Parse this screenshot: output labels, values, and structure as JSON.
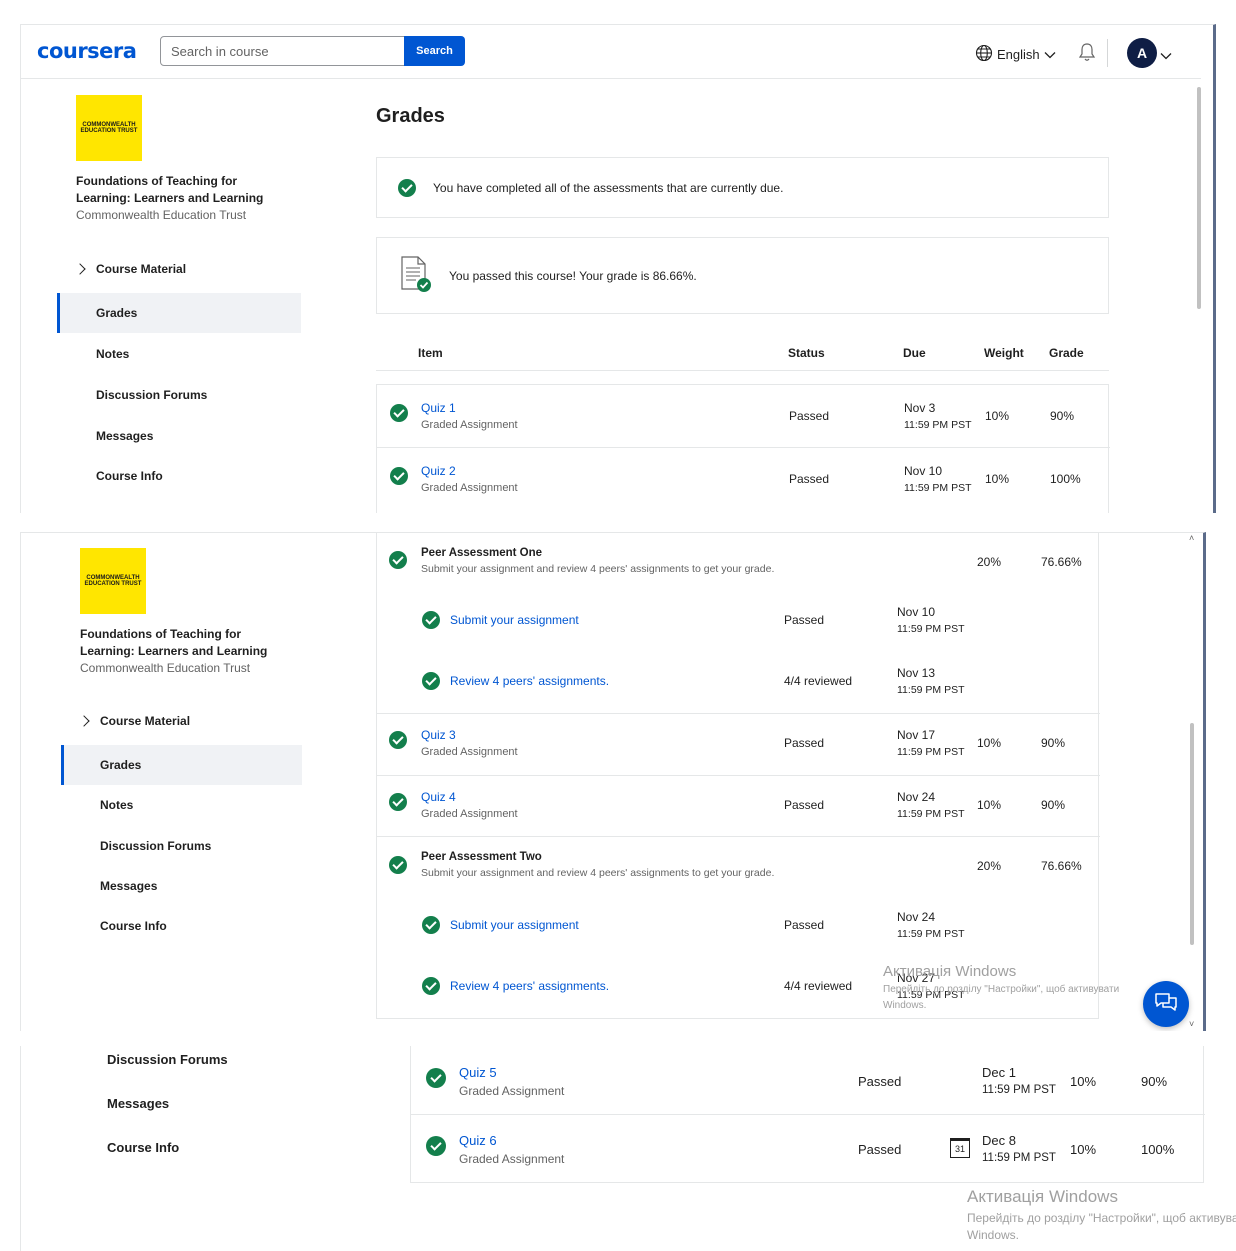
{
  "header": {
    "logo": "coursera",
    "search_placeholder": "Search in course",
    "search_button": "Search",
    "language": "English",
    "avatar_initial": "A"
  },
  "sidebar": {
    "course_title": "Foundations of Teaching for Learning: Learners and Learning",
    "course_org": "Commonwealth Education Trust",
    "logo_text": "COMMONWEALTH EDUCATION TRUST",
    "items": {
      "course_material": "Course Material",
      "grades": "Grades",
      "notes": "Notes",
      "discussion_forums": "Discussion Forums",
      "messages": "Messages",
      "course_info": "Course Info"
    }
  },
  "main": {
    "title": "Grades",
    "completed_msg": "You have completed all of the assessments that are currently due.",
    "passed_msg": "You passed this course! Your grade is 86.66%.",
    "columns": {
      "item": "Item",
      "status": "Status",
      "due": "Due",
      "weight": "Weight",
      "grade": "Grade"
    },
    "quiz1": {
      "name": "Quiz 1",
      "type": "Graded Assignment",
      "status": "Passed",
      "due_date": "Nov 3",
      "due_time": "11:59 PM PST",
      "weight": "10%",
      "grade": "90%"
    },
    "quiz2": {
      "name": "Quiz 2",
      "type": "Graded Assignment",
      "status": "Passed",
      "due_date": "Nov 10",
      "due_time": "11:59 PM PST",
      "weight": "10%",
      "grade": "100%"
    },
    "peer1": {
      "name": "Peer Assessment One",
      "desc": "Submit your assignment and review 4 peers' assignments to get your grade.",
      "weight": "20%",
      "grade": "76.66%",
      "submit": {
        "name": "Submit your assignment",
        "status": "Passed",
        "due_date": "Nov 10",
        "due_time": "11:59 PM PST"
      },
      "review": {
        "name": "Review 4 peers' assignments.",
        "status": "4/4 reviewed",
        "due_date": "Nov 13",
        "due_time": "11:59 PM PST"
      }
    },
    "quiz3": {
      "name": "Quiz 3",
      "type": "Graded Assignment",
      "status": "Passed",
      "due_date": "Nov 17",
      "due_time": "11:59 PM PST",
      "weight": "10%",
      "grade": "90%"
    },
    "quiz4": {
      "name": "Quiz 4",
      "type": "Graded Assignment",
      "status": "Passed",
      "due_date": "Nov 24",
      "due_time": "11:59 PM PST",
      "weight": "10%",
      "grade": "90%"
    },
    "peer2": {
      "name": "Peer Assessment Two",
      "desc": "Submit your assignment and review 4 peers' assignments to get your grade.",
      "weight": "20%",
      "grade": "76.66%",
      "submit": {
        "name": "Submit your assignment",
        "status": "Passed",
        "due_date": "Nov 24",
        "due_time": "11:59 PM PST"
      },
      "review": {
        "name": "Review 4 peers' assignments.",
        "status": "4/4 reviewed",
        "due_date": "Nov 27",
        "due_time": "11:59 PM PST"
      }
    },
    "quiz5": {
      "name": "Quiz 5",
      "type": "Graded Assignment",
      "status": "Passed",
      "due_date": "Dec 1",
      "due_time": "11:59 PM PST",
      "weight": "10%",
      "grade": "90%"
    },
    "quiz6": {
      "name": "Quiz 6",
      "type": "Graded Assignment",
      "status": "Passed",
      "due_date": "Dec 8",
      "due_time": "11:59 PM PST",
      "weight": "10%",
      "grade": "100%",
      "calendar_day": "31"
    }
  },
  "watermark": {
    "title": "Активація Windows",
    "line1": "Перейдіть до розділу \"Настройки\", щоб активувати",
    "line2": "Windows."
  },
  "colors": {
    "brand": "#0056d2",
    "success": "#137f4c",
    "logo_bg": "#ffe600"
  },
  "icons": [
    "globe-icon",
    "chevron-down-icon",
    "bell-icon",
    "check-circle-icon",
    "document-check-icon",
    "chevron-right-icon",
    "chat-icon",
    "calendar-icon"
  ]
}
